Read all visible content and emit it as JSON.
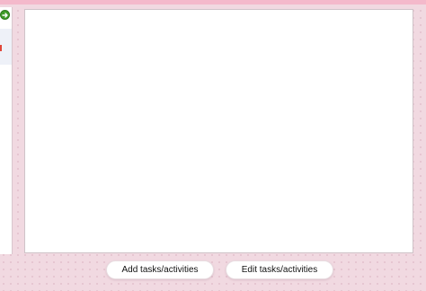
{
  "colors": {
    "background": "#f1d9e1",
    "top_strip": "#f4b9cb",
    "go_icon": "#3f9b27",
    "accent_mark": "#e0473a",
    "canvas": "#ffffff"
  },
  "sidebar": {
    "icon": "go-arrow-icon"
  },
  "actions": {
    "add_label": "Add tasks/activities",
    "edit_label": "Edit tasks/activities"
  }
}
